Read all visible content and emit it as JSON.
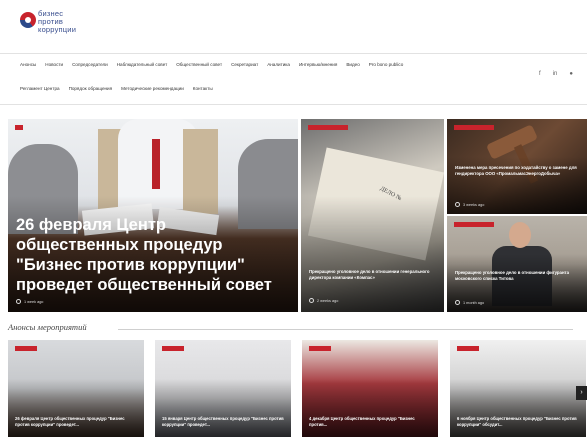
{
  "logo": {
    "lines": [
      "бизнес",
      "против",
      "коррупции"
    ]
  },
  "nav": {
    "row1": [
      "Анонсы",
      "Новости",
      "Сопредседатели",
      "Наблюдательный совет",
      "Общественный совет",
      "Секретариат",
      "Аналитика",
      "Интервью/мнения",
      "Видео",
      "Pro bono publico"
    ],
    "row2": [
      "Регламент Центра",
      "Порядок обращения",
      "Методические рекомендации",
      "Контакты"
    ]
  },
  "social": [
    "f",
    "in",
    "●"
  ],
  "hero": {
    "big": {
      "title": "26 февраля Центр общественных процедур \"Бизнес против коррупции\" проведет общественный совет",
      "time": "1 week ago"
    },
    "folder": {
      "title": "Прекращено уголовное дело в отношении генерального директора компании «Компас»",
      "time": "2 weeks ago",
      "label": "ДЕЛО №"
    },
    "gavel": {
      "title": "Изменена мера пресечения по ходатайству о замене для гендиректора ООО «ПромальмасЭнергоДобыча»",
      "time": "3 weeks ago"
    },
    "man": {
      "title": "Прекращено уголовное дело в отношении фигуранта московского списка Титова",
      "time": "1 month ago"
    }
  },
  "section": {
    "heading": "Анонсы мероприятий"
  },
  "cards": [
    {
      "title": "26 февраля Центр общественных процедур \"Бизнес против коррупции\" проведет..."
    },
    {
      "title": "15 января Центр общественных процедур \"Бизнес против коррупции\" проведет..."
    },
    {
      "title": "4 декабря Центр общественных процедур \"Бизнес против..."
    },
    {
      "title": "6 ноября Центр общественных процедур \"Бизнес против коррупции\" обсудит..."
    }
  ],
  "next_arrow": "›"
}
